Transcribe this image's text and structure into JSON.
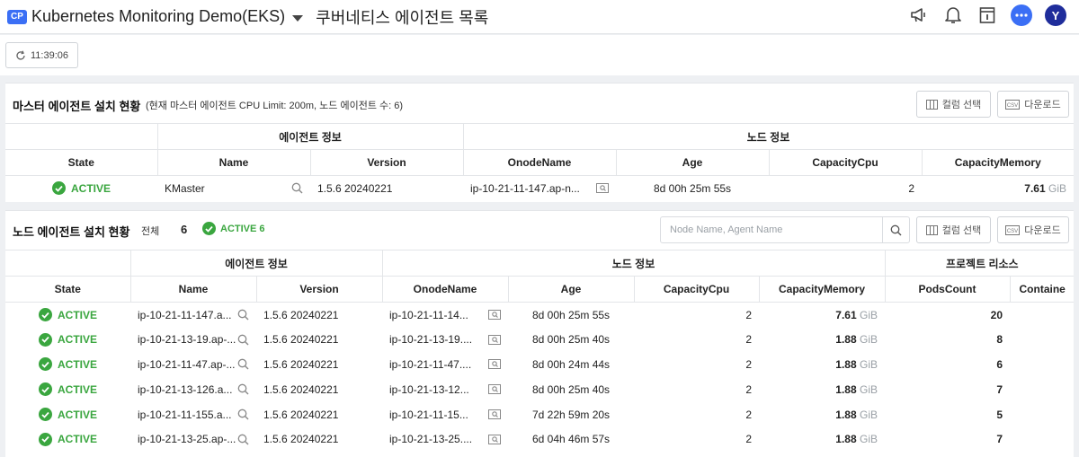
{
  "header": {
    "badge": "CP",
    "project_name": "Kubernetes Monitoring Demo(EKS)",
    "page_title": "쿠버네티스 에이전트 목록",
    "avatar_letter": "Y"
  },
  "toolbar": {
    "time": "11:39:06"
  },
  "master_panel": {
    "title": "마스터 에이전트 설치 현황",
    "subtitle": "(현재 마스터 에이전트 CPU Limit: 200m, 노드 에이전트 수: 6)",
    "column_select_label": "컬럼 선택",
    "download_label": "다운로드",
    "csv_label": "CSV",
    "groups": [
      "에이전트 정보",
      "노드 정보"
    ],
    "columns": [
      "State",
      "Name",
      "Version",
      "OnodeName",
      "Age",
      "CapacityCpu",
      "CapacityMemory"
    ],
    "row": {
      "state": "ACTIVE",
      "name": "KMaster",
      "version": "1.5.6 20240221",
      "onode": "ip-10-21-11-147.ap-n...",
      "age": "8d 00h 25m 55s",
      "cpu": "2",
      "mem": "7.61",
      "unit": "GiB"
    }
  },
  "node_panel": {
    "title": "노드 에이전트 설치 현황",
    "total_label": "전체",
    "total_count": "6",
    "active_summary": "ACTIVE 6",
    "search_placeholder": "Node Name, Agent Name",
    "column_select_label": "컬럼 선택",
    "download_label": "다운로드",
    "csv_label": "CSV",
    "groups": [
      "에이전트 정보",
      "노드 정보",
      "프로젝트 리소스"
    ],
    "columns": [
      "State",
      "Name",
      "Version",
      "OnodeName",
      "Age",
      "CapacityCpu",
      "CapacityMemory",
      "PodsCount",
      "Containe"
    ],
    "rows": [
      {
        "state": "ACTIVE",
        "name": "ip-10-21-11-147.a...",
        "version": "1.5.6 20240221",
        "onode": "ip-10-21-11-14...",
        "age": "8d 00h 25m 55s",
        "cpu": "2",
        "mem": "7.61",
        "unit": "GiB",
        "pods": "20"
      },
      {
        "state": "ACTIVE",
        "name": "ip-10-21-13-19.ap-...",
        "version": "1.5.6 20240221",
        "onode": "ip-10-21-13-19....",
        "age": "8d 00h 25m 40s",
        "cpu": "2",
        "mem": "1.88",
        "unit": "GiB",
        "pods": "8"
      },
      {
        "state": "ACTIVE",
        "name": "ip-10-21-11-47.ap-...",
        "version": "1.5.6 20240221",
        "onode": "ip-10-21-11-47....",
        "age": "8d 00h 24m 44s",
        "cpu": "2",
        "mem": "1.88",
        "unit": "GiB",
        "pods": "6"
      },
      {
        "state": "ACTIVE",
        "name": "ip-10-21-13-126.a...",
        "version": "1.5.6 20240221",
        "onode": "ip-10-21-13-12...",
        "age": "8d 00h 25m 40s",
        "cpu": "2",
        "mem": "1.88",
        "unit": "GiB",
        "pods": "7"
      },
      {
        "state": "ACTIVE",
        "name": "ip-10-21-11-155.a...",
        "version": "1.5.6 20240221",
        "onode": "ip-10-21-11-15...",
        "age": "7d 22h 59m 20s",
        "cpu": "2",
        "mem": "1.88",
        "unit": "GiB",
        "pods": "5"
      },
      {
        "state": "ACTIVE",
        "name": "ip-10-21-13-25.ap-...",
        "version": "1.5.6 20240221",
        "onode": "ip-10-21-13-25....",
        "age": "6d 04h 46m 57s",
        "cpu": "2",
        "mem": "1.88",
        "unit": "GiB",
        "pods": "7"
      }
    ]
  },
  "colors": {
    "active": "#3aa63f",
    "brand": "#3b6ff5",
    "avatar": "#1f2d9b"
  },
  "icons": [
    "cp-badge",
    "dropdown-caret-icon",
    "megaphone-icon",
    "bell-icon",
    "info-panel-icon",
    "chat-icon",
    "refresh-icon",
    "columns-icon",
    "csv-download-icon",
    "search-icon",
    "check-circle-icon",
    "node-detail-icon"
  ]
}
